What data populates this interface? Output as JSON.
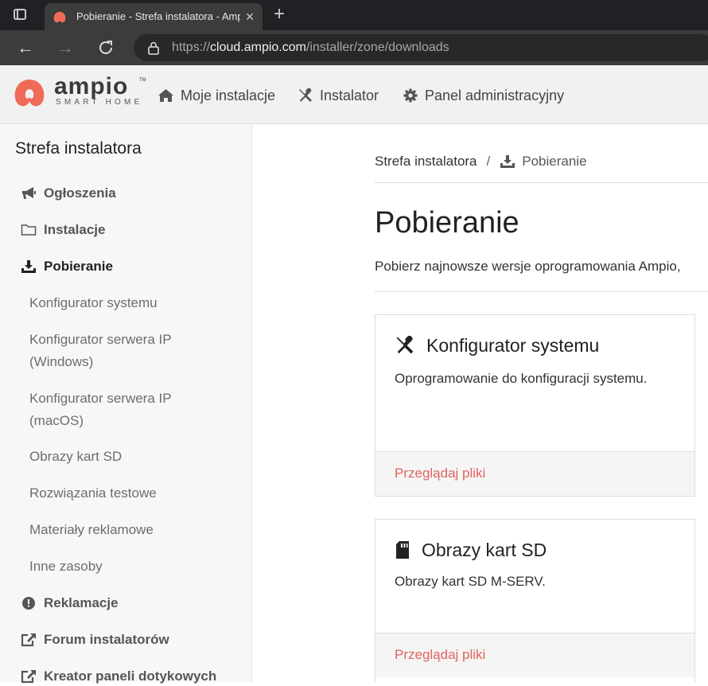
{
  "browser": {
    "tab_title": "Pobieranie - Strefa instalatora - Ampio",
    "url_scheme": "https://",
    "url_host": "cloud.ampio.com",
    "url_path": "/installer/zone/downloads"
  },
  "header": {
    "logo_word": "ampio",
    "logo_sub": "SMART HOME",
    "nav": [
      {
        "label": "Moje instalacje",
        "icon": "home-icon"
      },
      {
        "label": "Instalator",
        "icon": "tools-icon"
      },
      {
        "label": "Panel administracyjny",
        "icon": "gear-icon"
      }
    ]
  },
  "sidebar": {
    "title": "Strefa instalatora",
    "items": [
      {
        "label": "Ogłoszenia",
        "icon": "megaphone-icon"
      },
      {
        "label": "Instalacje",
        "icon": "folder-icon"
      },
      {
        "label": "Pobieranie",
        "icon": "download-icon",
        "active": true
      },
      {
        "label": "Reklamacje",
        "icon": "exclamation-circle-icon"
      },
      {
        "label": "Forum instalatorów",
        "icon": "external-link-icon"
      },
      {
        "label": "Kreator paneli dotykowych",
        "icon": "external-link-icon"
      }
    ],
    "subitems": [
      {
        "label": "Konfigurator systemu"
      },
      {
        "label": "Konfigurator serwera IP (Windows)"
      },
      {
        "label": "Konfigurator serwera IP (macOS)"
      },
      {
        "label": "Obrazy kart SD"
      },
      {
        "label": "Rozwiązania testowe"
      },
      {
        "label": "Materiały reklamowe"
      },
      {
        "label": "Inne zasoby"
      }
    ]
  },
  "main": {
    "breadcrumb_root": "Strefa instalatora",
    "breadcrumb_sep": "/",
    "breadcrumb_current": "Pobieranie",
    "title": "Pobieranie",
    "description": "Pobierz najnowsze wersje oprogramowania Ampio,",
    "cards": [
      {
        "title": "Konfigurator systemu",
        "icon": "tools-icon",
        "text": "Oprogramowanie do konfiguracji systemu.",
        "link": "Przeglądaj pliki"
      },
      {
        "title": "Obrazy kart SD",
        "icon": "sd-card-icon",
        "text": "Obrazy kart SD M-SERV.",
        "link": "Przeglądaj pliki"
      }
    ]
  },
  "colors": {
    "accent": "#e06460",
    "brand_logo": "#ef6b57"
  }
}
